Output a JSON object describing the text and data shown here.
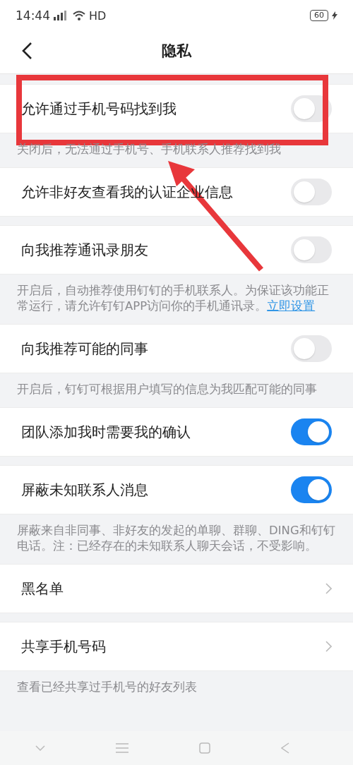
{
  "status_bar": {
    "time": "14:44",
    "network": "HD",
    "battery": "60"
  },
  "header": {
    "title": "隐私"
  },
  "sections": [
    {
      "gap": false,
      "row": {
        "kind": "toggle",
        "label": "允许通过手机号码找到我",
        "on": false
      },
      "note": {
        "text": "关闭后，无法通过手机号、手机联系人推荐找到我"
      }
    },
    {
      "gap": false,
      "row": {
        "kind": "toggle",
        "label": "允许非好友查看我的认证企业信息",
        "on": false
      }
    },
    {
      "gap": true,
      "row": {
        "kind": "toggle",
        "label": "向我推荐通讯录朋友",
        "on": false
      },
      "note": {
        "text": "开启后，自动推荐使用钉钉的手机联系人。为保证该功能正常运行，请允许钉钉APP访问你的手机通讯录。",
        "link": "立即设置"
      }
    },
    {
      "gap": false,
      "row": {
        "kind": "toggle",
        "label": "向我推荐可能的同事",
        "on": false
      },
      "note": {
        "text": "开启后，钉钉可根据用户填写的信息为我匹配可能的同事"
      }
    },
    {
      "gap": false,
      "row": {
        "kind": "toggle",
        "label": "团队添加我时需要我的确认",
        "on": true
      }
    },
    {
      "gap": true,
      "row": {
        "kind": "toggle",
        "label": "屏蔽未知联系人消息",
        "on": true
      },
      "note": {
        "text": "屏蔽来自非同事、非好友的发起的单聊、群聊、DING和钉钉电话。注：已经存在的未知联系人聊天会话，不受影响。"
      }
    },
    {
      "gap": false,
      "row": {
        "kind": "link",
        "label": "黑名单"
      }
    },
    {
      "gap": true,
      "row": {
        "kind": "link",
        "label": "共享手机号码"
      },
      "note": {
        "text": "查看已经共享过手机号的好友列表"
      }
    }
  ]
}
